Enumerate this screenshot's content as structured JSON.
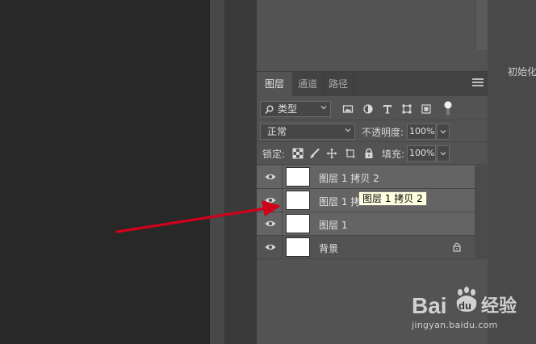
{
  "right_panel": {
    "label": "初始化"
  },
  "tabs": [
    {
      "label": "图层",
      "active": true
    },
    {
      "label": "通道",
      "active": false
    },
    {
      "label": "路径",
      "active": false
    }
  ],
  "filter": {
    "kind_label": "类型"
  },
  "blend": {
    "mode": "正常",
    "opacity_label": "不透明度:",
    "opacity_value": "100%"
  },
  "lock": {
    "label": "锁定:",
    "fill_label": "填充:",
    "fill_value": "100%"
  },
  "layers": [
    {
      "name": "图层 1 拷贝 2",
      "selected": true,
      "locked": false
    },
    {
      "name": "图层 1 拷",
      "selected": true,
      "locked": false
    },
    {
      "name": "图层 1",
      "selected": true,
      "locked": false
    },
    {
      "name": "背景",
      "selected": false,
      "locked": true
    }
  ],
  "tooltip": {
    "text": "图层 1 拷贝 2"
  },
  "watermark": {
    "brand": "Bai",
    "brand2": "du",
    "suffix": "经验",
    "url": "jingyan.baidu.com"
  },
  "colors": {
    "arrow": "#d0021b",
    "panel_bg": "#535353",
    "selected_row": "#646464"
  }
}
